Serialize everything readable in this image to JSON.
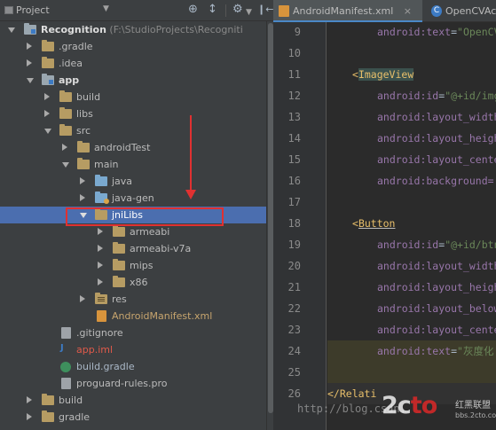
{
  "project_panel": {
    "title": "Project",
    "toolbar": {
      "sync_icon": "⊕",
      "collapse_icon": "↕",
      "settings_icon": "⚙",
      "hide_icon": "❙←"
    }
  },
  "tree": {
    "root": {
      "name": "Recognition",
      "path": "(F:\\StudioProjects\\Recogniti"
    },
    "items": [
      {
        "label": ".gradle"
      },
      {
        "label": ".idea"
      },
      {
        "label": "app"
      },
      {
        "label": "build"
      },
      {
        "label": "libs"
      },
      {
        "label": "src"
      },
      {
        "label": "androidTest"
      },
      {
        "label": "main"
      },
      {
        "label": "java"
      },
      {
        "label": "java-gen"
      },
      {
        "label": "jniLibs"
      },
      {
        "label": "armeabi"
      },
      {
        "label": "armeabi-v7a"
      },
      {
        "label": "mips"
      },
      {
        "label": "x86"
      },
      {
        "label": "res"
      },
      {
        "label": "AndroidManifest.xml"
      },
      {
        "label": ".gitignore"
      },
      {
        "label": "app.iml"
      },
      {
        "label": "build.gradle"
      },
      {
        "label": "proguard-rules.pro"
      },
      {
        "label": "build"
      },
      {
        "label": "gradle"
      }
    ]
  },
  "editor": {
    "tabs": [
      {
        "label": "AndroidManifest.xml",
        "close": "×"
      },
      {
        "label": "OpenCVAct"
      }
    ],
    "lines": [
      {
        "n": "9",
        "attr": "android:text",
        "val": "\"OpenCV"
      },
      {
        "n": "10",
        "text": ""
      },
      {
        "n": "11",
        "tag": "ImageView"
      },
      {
        "n": "12",
        "attr": "android:id",
        "val": "\"@+id/img"
      },
      {
        "n": "13",
        "attr": "android:layout_width"
      },
      {
        "n": "14",
        "attr": "android:layout_heigh"
      },
      {
        "n": "15",
        "attr": "android:layout_cente"
      },
      {
        "n": "16",
        "attr": "android:background="
      },
      {
        "n": "17",
        "text": ""
      },
      {
        "n": "18",
        "tag": "Button"
      },
      {
        "n": "19",
        "attr": "android:id",
        "val": "\"@+id/btn"
      },
      {
        "n": "20",
        "attr": "android:layout_width"
      },
      {
        "n": "21",
        "attr": "android:layout_heigh"
      },
      {
        "n": "22",
        "attr": "android:layout_below"
      },
      {
        "n": "23",
        "attr": "android:layout_cente"
      },
      {
        "n": "24",
        "attr": "android:text",
        "val": "\"灰度化"
      },
      {
        "n": "25",
        "text": ""
      },
      {
        "n": "26",
        "close_tag": "Relati"
      }
    ]
  },
  "watermark": {
    "url": "http://blog.csdn.",
    "logo_a": "2c",
    "logo_b": "to",
    "logo_c": ".com",
    "sub1": "红黑联盟",
    "sub2": "bbs.2cto.com"
  },
  "colors": {
    "panel_bg": "#3c3f41",
    "editor_bg": "#2b2b2b",
    "selection": "#4b6eaf",
    "annotation": "#e03131"
  }
}
